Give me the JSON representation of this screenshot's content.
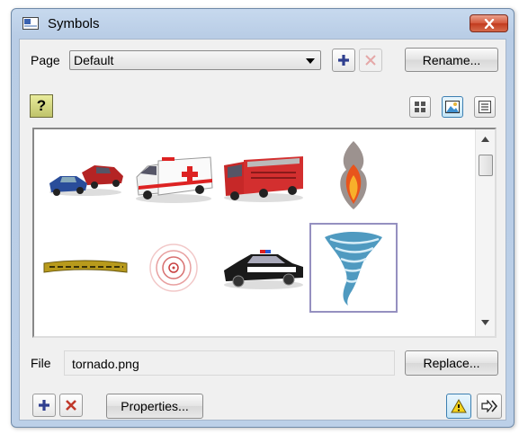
{
  "window": {
    "title": "Symbols"
  },
  "page": {
    "label": "Page",
    "selected": "Default",
    "rename_label": "Rename..."
  },
  "gallery": {
    "items": [
      {
        "name": "crashed cars"
      },
      {
        "name": "ambulance"
      },
      {
        "name": "fire truck"
      },
      {
        "name": "fire"
      },
      {
        "name": "caution tape"
      },
      {
        "name": "radio signal"
      },
      {
        "name": "police car"
      },
      {
        "name": "tornado",
        "selected": true
      }
    ]
  },
  "file": {
    "label": "File",
    "value": "tornado.png",
    "replace_label": "Replace..."
  },
  "bottom": {
    "properties_label": "Properties..."
  },
  "icons": {
    "title": "window-icon",
    "close": "close-icon",
    "add_page": "plus-icon",
    "delete_page": "x-icon",
    "help": "question-icon",
    "view_grid": "grid-view-icon",
    "view_thumbs": "thumbnail-view-icon",
    "view_list": "list-view-icon",
    "add_symbol": "plus-icon",
    "delete_symbol": "x-icon",
    "warning": "warning-icon",
    "next": "forward-icon"
  },
  "colors": {
    "accent": "#2f3f8f",
    "delete": "#c0392b",
    "selection": "#9590c0"
  }
}
